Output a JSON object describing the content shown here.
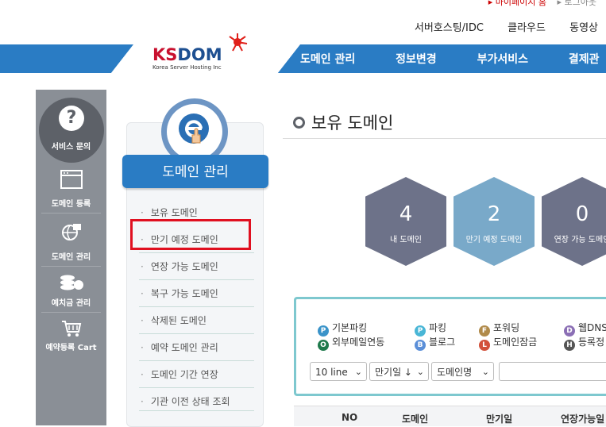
{
  "util": {
    "mypage": "▸ 마이페이지 홈",
    "logout": "▸ 로그아웃"
  },
  "topnav": [
    "서버호스팅/IDC",
    "클라우드",
    "동영상"
  ],
  "logo": {
    "main_red": "KS",
    "main_blue": "DOM",
    "sub": "Korea Server Hosting Inc"
  },
  "mainmenu": [
    "도메인 관리",
    "정보변경",
    "부가서비스",
    "결제관"
  ],
  "quick": {
    "service": "서비스 문의",
    "items": [
      "도메인 등록",
      "도메인 관리",
      "예치금 관리",
      "예약등록 Cart"
    ]
  },
  "panel": {
    "title": "도메인 관리",
    "items": [
      "보유 도메인",
      "만기 예정 도메인",
      "연장 가능 도메인",
      "복구 가능 도메인",
      "삭제된 도메인",
      "예약 도메인 관리",
      "도메인 기간 연장",
      "기관 이전 상태 조회"
    ]
  },
  "page_title": "보유 도메인",
  "stats": [
    {
      "num": "4",
      "label": "내 도메인",
      "color": "#6d7289"
    },
    {
      "num": "2",
      "label": "만기 예정 도메인",
      "color": "#79a9c9"
    },
    {
      "num": "0",
      "label": "연장 가능 도메인",
      "color": "#6d7289"
    }
  ],
  "legend": [
    {
      "badge": "P",
      "label": "기본파킹",
      "color": "#3a93c9"
    },
    {
      "badge": "P",
      "label": "파킹",
      "color": "#49b6d6"
    },
    {
      "badge": "F",
      "label": "포워딩",
      "color": "#b08a4a"
    },
    {
      "badge": "D",
      "label": "웹DNS",
      "color": "#8b6fb5"
    },
    {
      "badge": "O",
      "label": "외부메일연동",
      "color": "#1f7a4c"
    },
    {
      "badge": "B",
      "label": "블로그",
      "color": "#5b8fd8"
    },
    {
      "badge": "L",
      "label": "도메인잠금",
      "color": "#d2513b"
    },
    {
      "badge": "H",
      "label": "등록정",
      "color": "#555555"
    }
  ],
  "filters": {
    "page_size": "10 line",
    "sort": "만기일 ↓",
    "field": "도메인명"
  },
  "table_headers": [
    "NO",
    "도메인",
    "만기일",
    "연장가능일"
  ]
}
